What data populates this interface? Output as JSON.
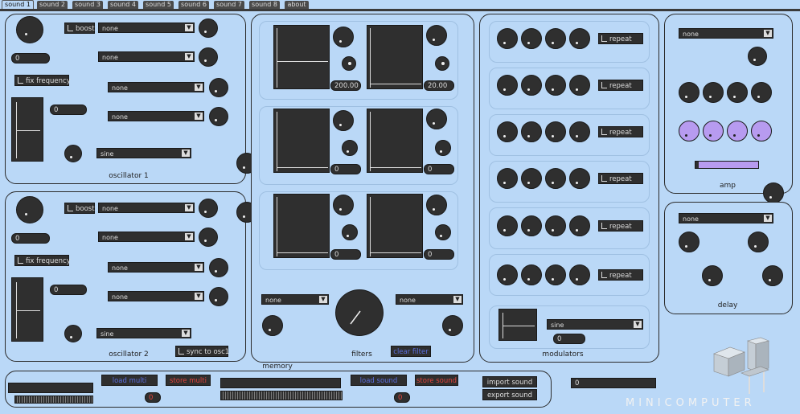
{
  "tabs": [
    "sound 1",
    "sound 2",
    "sound 3",
    "sound 4",
    "sound 5",
    "sound 6",
    "sound 7",
    "sound 8",
    "about"
  ],
  "osc1": {
    "title": "oscillator 1",
    "boost": "boost",
    "fix_frequency": "fix frequency",
    "freq_value": "0",
    "tune_value": "0",
    "dd_top": "none",
    "dd_mid": "none",
    "dd_a": "none",
    "dd_b": "none",
    "waveform": "sine"
  },
  "osc2": {
    "title": "oscillator 2",
    "boost": "boost",
    "fix_frequency": "fix frequency",
    "freq_value": "0",
    "tune_value": "0",
    "dd_top": "none",
    "dd_mid": "none",
    "dd_a": "none",
    "dd_b": "none",
    "waveform": "sine",
    "sync": "sync to osc1"
  },
  "filters": {
    "title": "filters",
    "v1": "200.00",
    "v2": "20.00",
    "v3": "0",
    "v4": "0",
    "v5": "0",
    "v6": "0",
    "dd_left": "none",
    "dd_right": "none",
    "clear": "clear filter"
  },
  "modulators": {
    "title": "modulators",
    "repeat": "repeat",
    "waveform": "sine",
    "value": "0"
  },
  "amp": {
    "title": "amp",
    "dd": "none"
  },
  "delay": {
    "title": "delay",
    "dd": "none"
  },
  "memory": {
    "title": "memory",
    "load_multi": "load multi",
    "store_multi": "store multi",
    "load_sound": "load sound",
    "store_sound": "store sound",
    "import_sound": "import sound",
    "export_sound": "export sound",
    "counter1": "0",
    "counter2": "0"
  },
  "status_value": "0",
  "brand": "MINICOMPUTER",
  "colors": {
    "background": "#bad8f7",
    "control": "#2f2f2f",
    "purple_knob": "#b79bf0",
    "red_text": "#e2443c",
    "blue_text": "#5b6fe0"
  }
}
